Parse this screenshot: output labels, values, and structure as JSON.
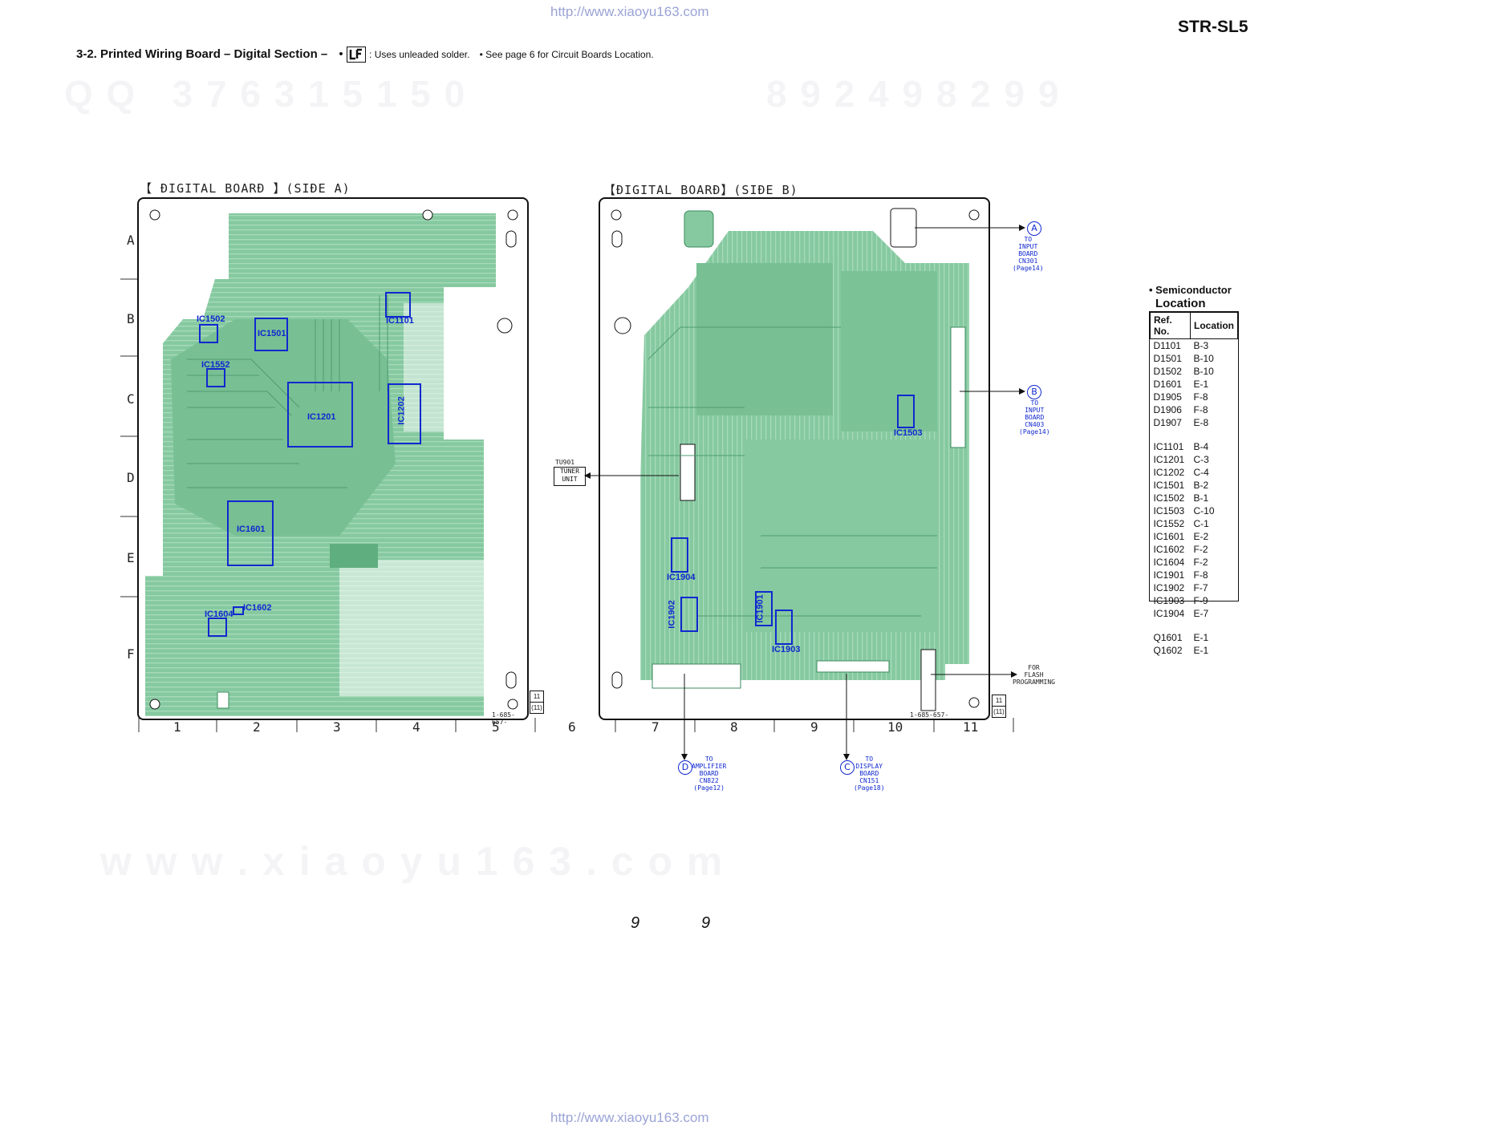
{
  "urls": {
    "top": "http://www.xiaoyu163.com",
    "bottom": "http://www.xiaoyu163.com"
  },
  "model": "STR-SL5",
  "heading": {
    "title": "3-2. Printed Wiring Board  – Digital Section –",
    "bullet": "•",
    "lf_note": ": Uses unleaded solder.",
    "see_note": "• See page 6 for Circuit Boards Location."
  },
  "watermarks": {
    "top_left": "Q Q   3 7 6 3 1 5 1 5 0",
    "top_right": "8 9 2 4 9 8 2 9 9",
    "bottom": "w w w . x i a o y u 1 6 3 . c o m"
  },
  "board_a": {
    "label": "【 ÐIGITAL  BOARÐ 】(SIÐE  A)",
    "part_no": "1-685-657-",
    "ics": [
      "IC1502",
      "IC1501",
      "IC1101",
      "IC1552",
      "IC1201",
      "IC1202",
      "IC1601",
      "IC1602",
      "IC1604"
    ]
  },
  "board_b": {
    "label": "【ÐIGITAL  BOARÐ】(SIÐE  B)",
    "part_no": "1-685-657-",
    "ics": [
      "IC1503",
      "IC1904",
      "IC1902",
      "IC1901",
      "IC1903"
    ]
  },
  "rows": [
    "A",
    "B",
    "C",
    "D",
    "E",
    "F"
  ],
  "cols": [
    "1",
    "2",
    "3",
    "4",
    "5",
    "6",
    "7",
    "8",
    "9",
    "10",
    "11"
  ],
  "side_tags": {
    "left": "11",
    "left_sub": "(11)",
    "right": "11",
    "right_sub": "(11)"
  },
  "tuner": {
    "ref": "TU901",
    "label": "TUNER\nUNIT"
  },
  "connectors": {
    "A": {
      "letter": "A",
      "text": "TO\nINPUT\nBOARD\nCN301\n(Page14)"
    },
    "B": {
      "letter": "B",
      "text": "TO\nINPUT\nBOARD\nCN403\n(Page14)"
    },
    "D": {
      "letter": "D",
      "text": "TO\nAMPLIFIER\nBOARD\nCN822\n(Page12)"
    },
    "C": {
      "letter": "C",
      "text": "TO\nDISPLAY\nBOARD\nCN151\n(Page18)"
    },
    "flash": "FOR\nFLASH\nPROGRAMMING"
  },
  "semiconductor": {
    "title_line1": "• Semiconductor",
    "title_line2": "Location",
    "headers": [
      "Ref. No.",
      "Location"
    ],
    "groups": [
      [
        [
          "D1101",
          "B-3"
        ],
        [
          "D1501",
          "B-10"
        ],
        [
          "D1502",
          "B-10"
        ],
        [
          "D1601",
          "E-1"
        ],
        [
          "D1905",
          "F-8"
        ],
        [
          "D1906",
          "F-8"
        ],
        [
          "D1907",
          "E-8"
        ]
      ],
      [
        [
          "IC1101",
          "B-4"
        ],
        [
          "IC1201",
          "C-3"
        ],
        [
          "IC1202",
          "C-4"
        ],
        [
          "IC1501",
          "B-2"
        ],
        [
          "IC1502",
          "B-1"
        ],
        [
          "IC1503",
          "C-10"
        ],
        [
          "IC1552",
          "C-1"
        ],
        [
          "IC1601",
          "E-2"
        ],
        [
          "IC1602",
          "F-2"
        ],
        [
          "IC1604",
          "F-2"
        ],
        [
          "IC1901",
          "F-8"
        ],
        [
          "IC1902",
          "F-7"
        ],
        [
          "IC1903",
          "F-9"
        ],
        [
          "IC1904",
          "E-7"
        ]
      ],
      [
        [
          "Q1601",
          "E-1"
        ],
        [
          "Q1602",
          "E-1"
        ]
      ]
    ]
  },
  "page_numbers": [
    "9",
    "9"
  ],
  "colors": {
    "pcb": "#86c9a0",
    "pcb_dark": "#5fae80",
    "ic_box": "#1028d0",
    "url": "#9aa3d6"
  }
}
